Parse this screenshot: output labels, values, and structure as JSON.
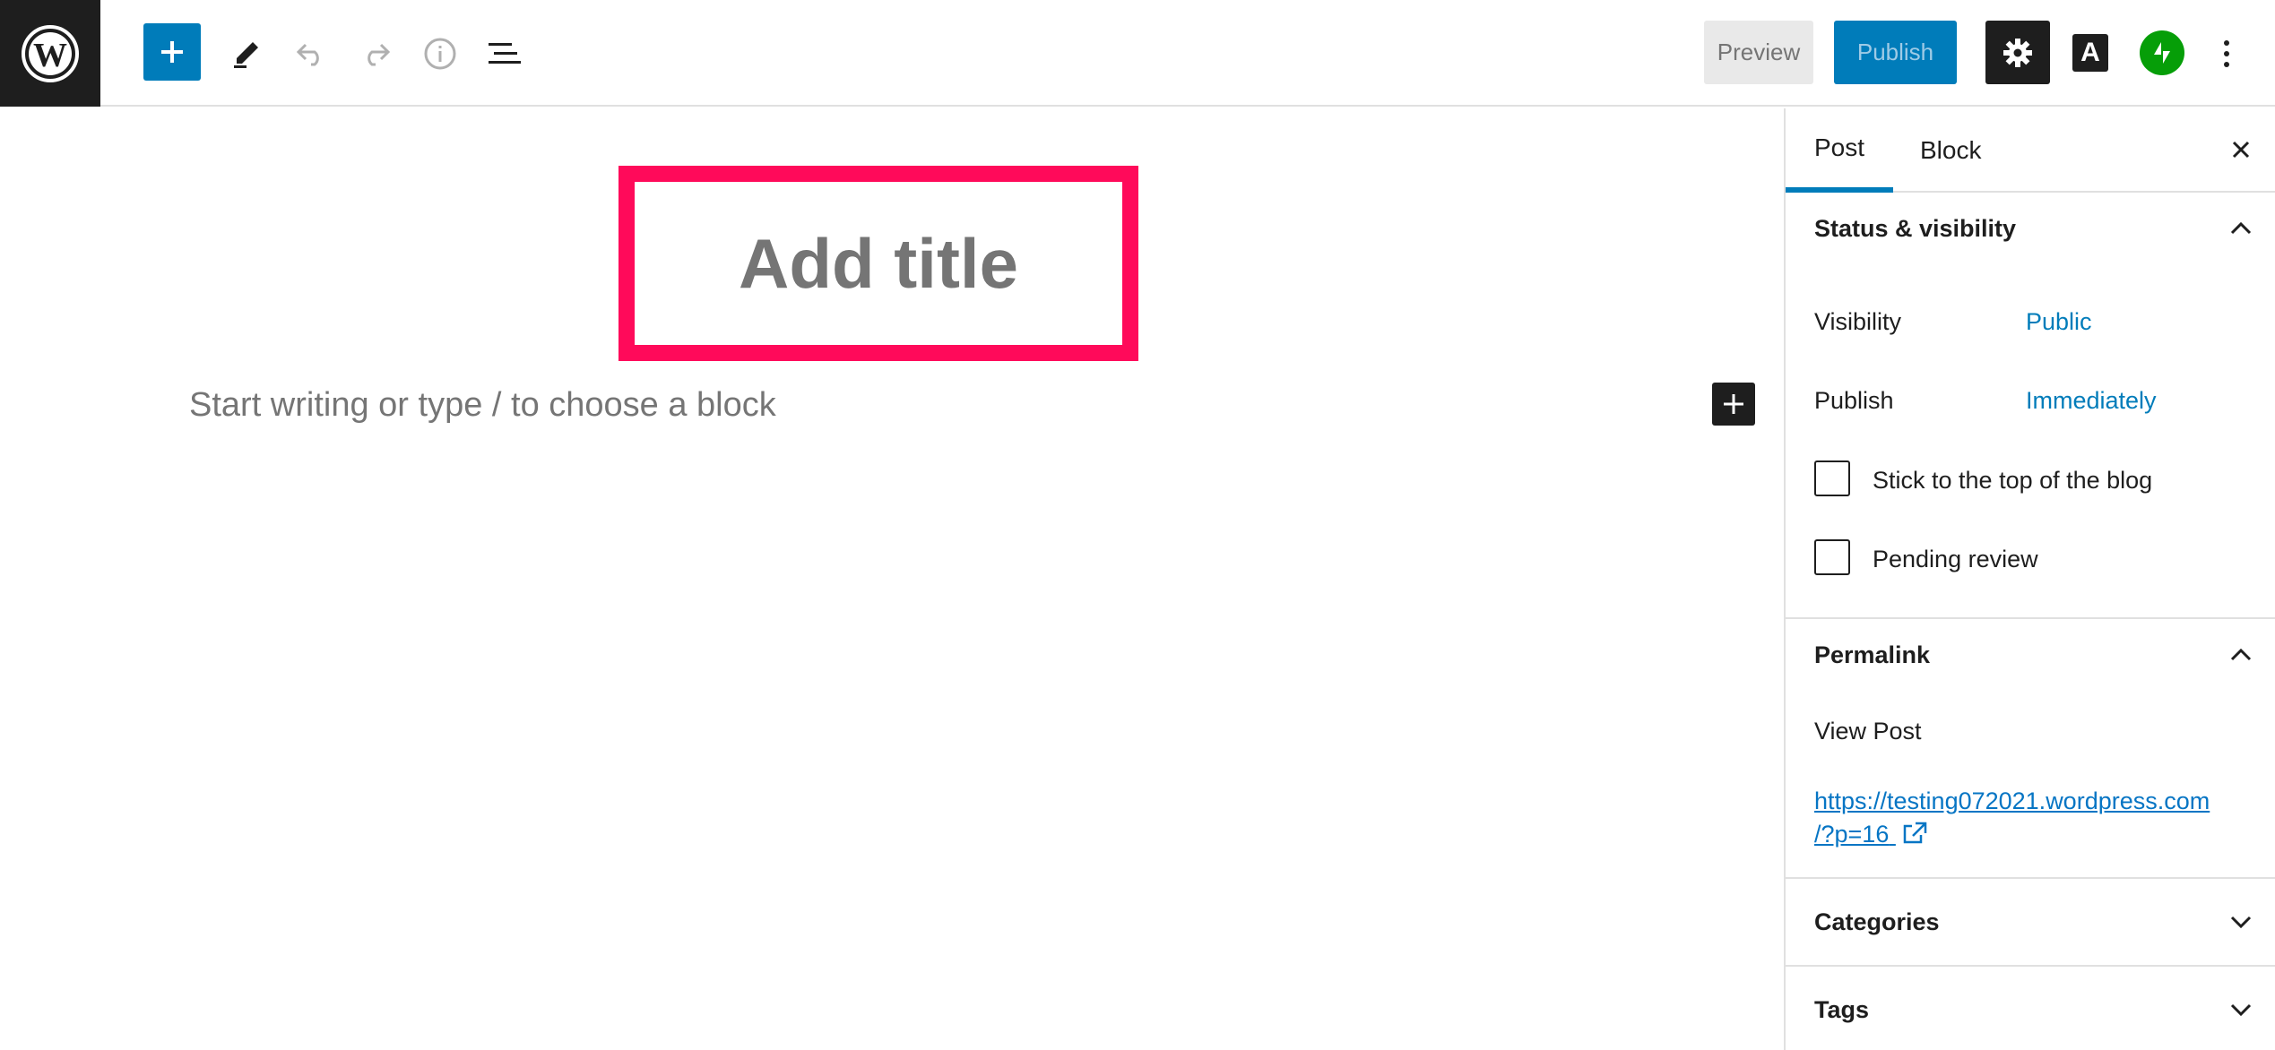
{
  "toolbar": {
    "preview_label": "Preview",
    "publish_label": "Publish",
    "amp_label": "A",
    "icons": [
      "wordpress-logo-icon",
      "plus-icon",
      "pencil-icon",
      "undo-icon",
      "redo-icon",
      "info-icon",
      "list-view-icon",
      "gear-icon",
      "jetpack-icon",
      "more-vertical-icon"
    ],
    "colors": {
      "accent": "#007cba",
      "dark": "#1e1e1e",
      "jetpack": "#069e08",
      "highlight": "#ff0a5a"
    }
  },
  "editor": {
    "title_placeholder": "Add title",
    "body_placeholder": "Start writing or type / to choose a block"
  },
  "sidebar": {
    "tabs": [
      {
        "label": "Post",
        "active": true
      },
      {
        "label": "Block",
        "active": false
      }
    ],
    "status": {
      "heading": "Status & visibility",
      "visibility_label": "Visibility",
      "visibility_value": "Public",
      "publish_label": "Publish",
      "publish_value": "Immediately",
      "sticky_label": "Stick to the top of the blog",
      "pending_label": "Pending review"
    },
    "permalink": {
      "heading": "Permalink",
      "view_post_label": "View Post",
      "url_line1": "https://testing072021.wordpress.com",
      "url_line2": "/?p=16"
    },
    "categories_heading": "Categories",
    "tags_heading": "Tags"
  }
}
